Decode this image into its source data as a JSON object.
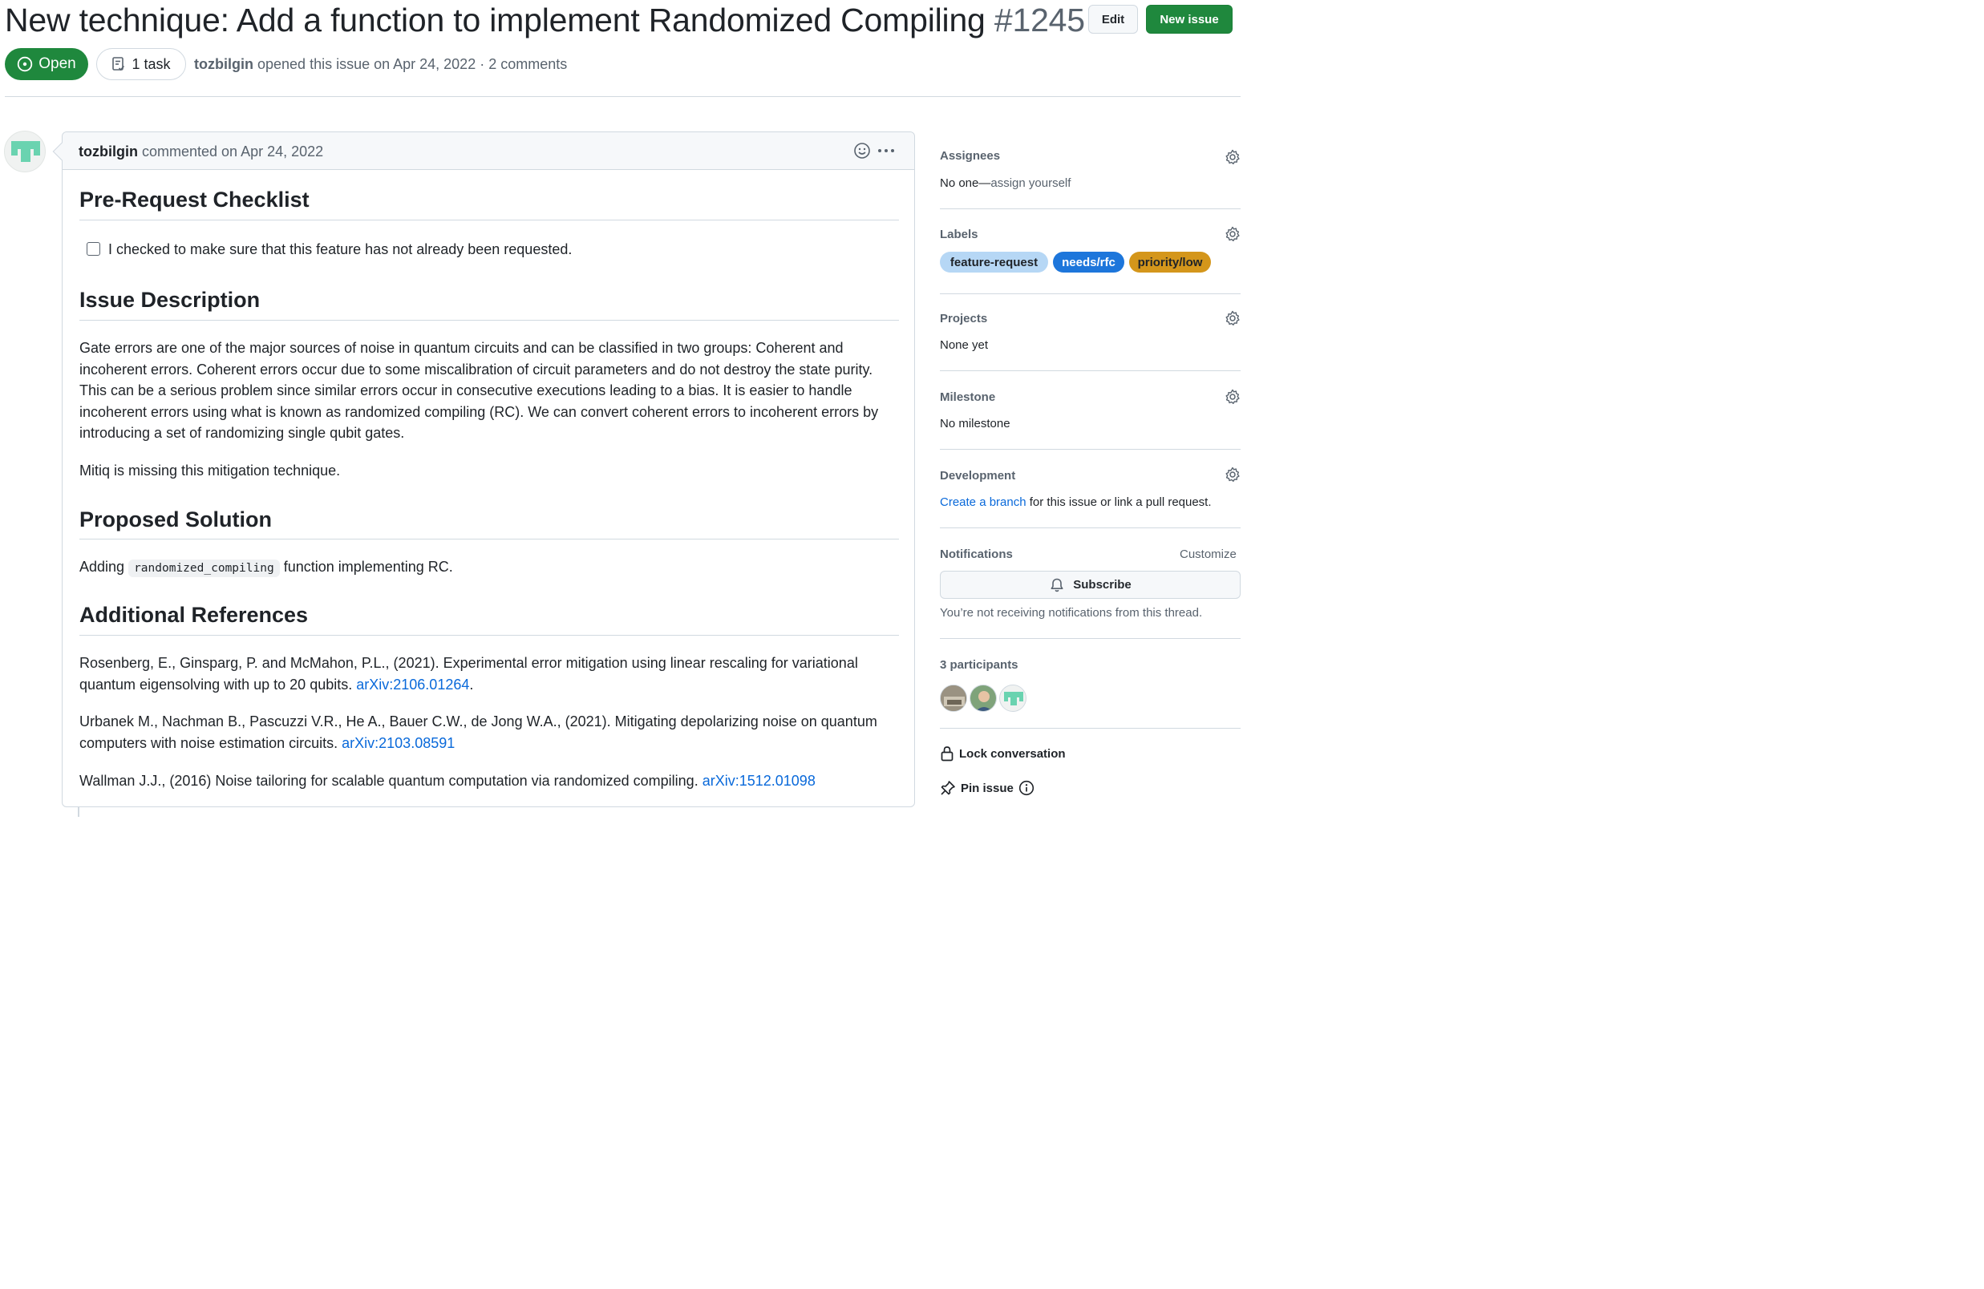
{
  "issue": {
    "title": "New technique: Add a function to implement Randomized Compiling",
    "number": "#1245",
    "state": "Open",
    "tasks": "1 task",
    "author": "tozbilgin",
    "opened_text": "opened this issue on Apr 24, 2022 · 2 comments"
  },
  "header_buttons": {
    "edit": "Edit",
    "new_issue": "New issue"
  },
  "comment": {
    "author": "tozbilgin",
    "action": "commented on Apr 24, 2022",
    "sections": {
      "checklist_heading": "Pre-Request Checklist",
      "checklist_item": "I checked to make sure that this feature has not already been requested.",
      "description_heading": "Issue Description",
      "description_p1": "Gate errors are one of the major sources of noise in quantum circuits and can be classified in two groups: Coherent and incoherent errors. Coherent errors occur due to some miscalibration of circuit parameters and do not destroy the state purity. This can be a serious problem since similar errors occur in consecutive executions leading to a bias. It is easier to handle incoherent errors using what is known as randomized compiling (RC). We can convert coherent errors to incoherent errors by introducing a set of randomizing single qubit gates.",
      "description_p2": "Mitiq is missing this mitigation technique.",
      "solution_heading": "Proposed Solution",
      "solution_prefix": "Adding",
      "solution_code": "randomized_compiling",
      "solution_suffix": "function implementing RC.",
      "references_heading": "Additional References",
      "ref1_text": "Rosenberg, E., Ginsparg, P. and McMahon, P.L., (2021). Experimental error mitigation using linear rescaling for variational quantum eigensolving with up to 20 qubits.",
      "ref1_link": "arXiv:2106.01264",
      "ref1_end": ".",
      "ref2_text": "Urbanek M., Nachman B., Pascuzzi V.R., He A., Bauer C.W., de Jong W.A., (2021). Mitigating depolarizing noise on quantum computers with noise estimation circuits.",
      "ref2_link": "arXiv:2103.08591",
      "ref3_text": "Wallman J.J., (2016) Noise tailoring for scalable quantum computation via randomized compiling.",
      "ref3_link": "arXiv:1512.01098"
    }
  },
  "sidebar": {
    "assignees": {
      "heading": "Assignees",
      "value_prefix": "No one—",
      "value_link": "assign yourself"
    },
    "labels": {
      "heading": "Labels",
      "items": [
        {
          "name": "feature-request",
          "bg": "#b6d7f5",
          "fg": "#1f2328"
        },
        {
          "name": "needs/rfc",
          "bg": "#1d76db",
          "fg": "#ffffff"
        },
        {
          "name": "priority/low",
          "bg": "#d4961b",
          "fg": "#1f2328"
        }
      ]
    },
    "projects": {
      "heading": "Projects",
      "value": "None yet"
    },
    "milestone": {
      "heading": "Milestone",
      "value": "No milestone"
    },
    "development": {
      "heading": "Development",
      "link": "Create a branch",
      "rest": " for this issue or link a pull request."
    },
    "notifications": {
      "heading": "Notifications",
      "customize": "Customize",
      "subscribe": "Subscribe",
      "note": "You’re not receiving notifications from this thread."
    },
    "participants": {
      "heading": "3 participants"
    },
    "lock": "Lock conversation",
    "pin": "Pin issue"
  },
  "colors": {
    "open_green": "#1f883d",
    "link_blue": "#0969da",
    "avatar_teal": "#6ad3b0"
  }
}
